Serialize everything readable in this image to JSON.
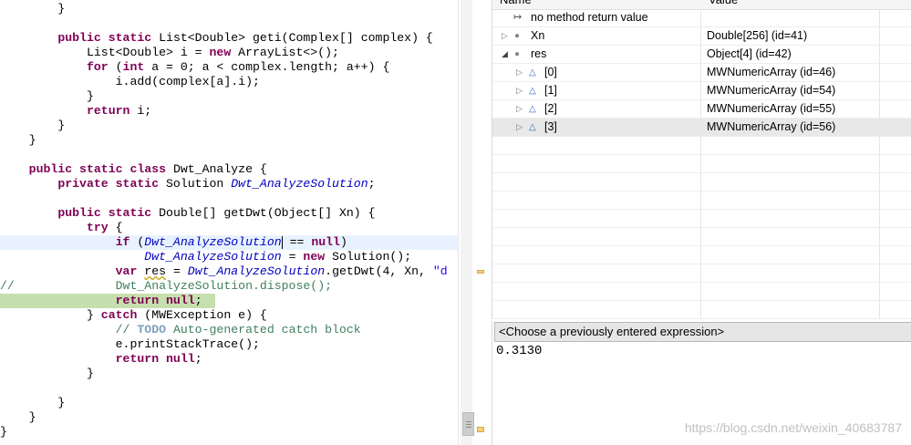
{
  "editor": {
    "lines": [
      "        }",
      "",
      "        public static List<Double> geti(Complex[] complex) {",
      "            List<Double> i = new ArrayList<>();",
      "            for (int a = 0; a < complex.length; a++) {",
      "                i.add(complex[a].i);",
      "            }",
      "            return i;",
      "        }",
      "    }",
      "",
      "    public static class Dwt_Analyze {",
      "        private static Solution Dwt_AnalyzeSolution;",
      "",
      "        public static Double[] getDwt(Object[] Xn) {",
      "            try {",
      "                if (Dwt_AnalyzeSolution == null)",
      "                    Dwt_AnalyzeSolution = new Solution();",
      "                var res = Dwt_AnalyzeSolution.getDwt(4, Xn, \"d",
      "//              Dwt_AnalyzeSolution.dispose();",
      "                return null;",
      "            } catch (MWException e) {",
      "                // TODO Auto-generated catch block",
      "                e.printStackTrace();",
      "                return null;",
      "            }",
      "",
      "        }",
      "    }",
      "}"
    ]
  },
  "variables": {
    "columns": {
      "name": "Name",
      "value": "Value"
    },
    "rows": [
      {
        "name": "no method return value",
        "value": "",
        "icon": "method-return-icon",
        "twisty": ""
      },
      {
        "name": "Xn",
        "value": "Double[256]  (id=41)",
        "icon": "local-variable-icon",
        "twisty": "▷"
      },
      {
        "name": "res",
        "value": "Object[4]  (id=42)",
        "icon": "local-variable-icon",
        "twisty": "◢"
      },
      {
        "name": "[0]",
        "value": "MWNumericArray  (id=46)",
        "icon": "array-element-icon",
        "twisty": "▷"
      },
      {
        "name": "[1]",
        "value": "MWNumericArray  (id=54)",
        "icon": "array-element-icon",
        "twisty": "▷"
      },
      {
        "name": "[2]",
        "value": "MWNumericArray  (id=55)",
        "icon": "array-element-icon",
        "twisty": "▷"
      },
      {
        "name": "[3]",
        "value": "MWNumericArray  (id=56)",
        "icon": "array-element-icon",
        "twisty": "▷"
      }
    ]
  },
  "expressions": {
    "placeholder": "<Choose a previously entered expression>",
    "result": "0.3130"
  },
  "watermark": "https://blog.csdn.net/weixin_40683787"
}
